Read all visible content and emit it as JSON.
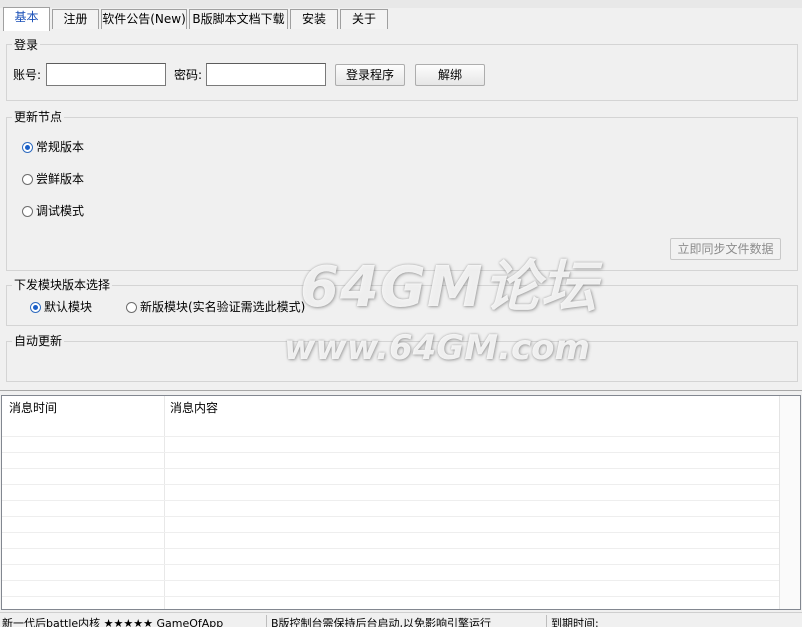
{
  "tabs": [
    {
      "label": "基本",
      "active": true
    },
    {
      "label": "注册",
      "active": false
    },
    {
      "label": "软件公告(New)",
      "active": false
    },
    {
      "label": "B版脚本文档下载",
      "active": false
    },
    {
      "label": "安装",
      "active": false
    },
    {
      "label": "关于",
      "active": false
    }
  ],
  "login": {
    "group_label": "登录",
    "account_label": "账号:",
    "account_value": "",
    "password_label": "密码:",
    "password_value": "",
    "login_button": "登录程序",
    "unbind_button": "解绑"
  },
  "update_node": {
    "group_label": "更新节点",
    "options": [
      {
        "label": "常规版本",
        "checked": true
      },
      {
        "label": "尝鲜版本",
        "checked": false
      },
      {
        "label": "调试模式",
        "checked": false
      }
    ],
    "sync_button": "立即同步文件数据"
  },
  "module_select": {
    "group_label": "下发模块版本选择",
    "options": [
      {
        "label": "默认模块",
        "checked": true
      },
      {
        "label": "新版模块(实名验证需选此模式)",
        "checked": false
      }
    ]
  },
  "auto_update": {
    "group_label": "自动更新"
  },
  "watermark": {
    "line1": "64GM论坛",
    "line2": "www.64GM.com"
  },
  "message_list": {
    "columns": [
      "消息时间",
      "消息内容"
    ],
    "rows": []
  },
  "status_bar": {
    "left": "新一代后battle内核 ★★★★★ GameOfApp",
    "middle": "B版控制台需保持后台启动,以免影响引擎运行",
    "right": "到期时间:"
  }
}
